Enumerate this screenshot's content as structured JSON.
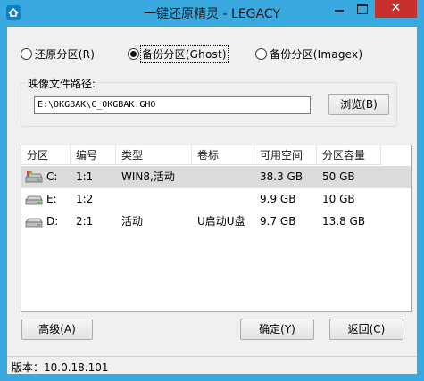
{
  "window": {
    "title": "一键还原精灵 - LEGACY",
    "close_glyph": "✕"
  },
  "mode": {
    "options": [
      {
        "label": "还原分区(R)",
        "checked": false
      },
      {
        "label": "备份分区(Ghost)",
        "checked": true
      },
      {
        "label": "备份分区(Imagex)",
        "checked": false
      }
    ]
  },
  "image_path": {
    "legend": "映像文件路径:",
    "value": "E:\\OKGBAK\\C_OKGBAK.GHO",
    "browse_label": "浏览(B)"
  },
  "table": {
    "columns": [
      "分区",
      "编号",
      "类型",
      "卷标",
      "可用空间",
      "分区容量"
    ],
    "rows": [
      {
        "drive": "C:",
        "number": "1:1",
        "type": "WIN8,活动",
        "label": "",
        "free": "38.3 GB",
        "size": "50 GB",
        "selected": true
      },
      {
        "drive": "E:",
        "number": "1:2",
        "type": "",
        "label": "",
        "free": "9.9 GB",
        "size": "10 GB",
        "selected": false
      },
      {
        "drive": "D:",
        "number": "2:1",
        "type": "活动",
        "label": "U启动U盘",
        "free": "9.7 GB",
        "size": "13.8 GB",
        "selected": false
      }
    ]
  },
  "buttons": {
    "advanced": "高级(A)",
    "ok": "确定(Y)",
    "back": "返回(C)"
  },
  "status": {
    "version": "版本：10.0.18.101"
  }
}
